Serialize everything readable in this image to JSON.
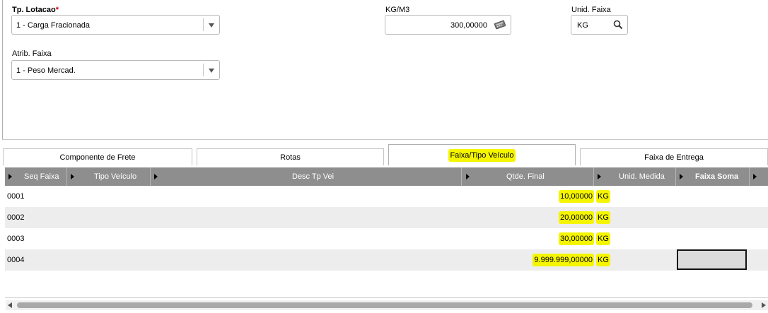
{
  "form": {
    "tp_lotacao": {
      "label": "Tp. Lotacao",
      "required_mark": "*",
      "value": "1 - Carga Fracionada"
    },
    "kg_m3": {
      "label": "KG/M3",
      "value": "300,00000",
      "icon": "calculator-icon"
    },
    "unid_faixa": {
      "label": "Unid. Faixa",
      "value": "KG",
      "icon": "search-icon"
    },
    "atrib_faixa": {
      "label": "Atrib. Faixa",
      "value": "1 - Peso Mercad."
    }
  },
  "tabs": [
    {
      "label": "Componente de Frete",
      "active": false
    },
    {
      "label": "Rotas",
      "active": false
    },
    {
      "label": "Faixa/Tipo Veículo",
      "active": true
    },
    {
      "label": "Faixa de Entrega",
      "active": false
    }
  ],
  "grid": {
    "columns": [
      "Seq Faixa",
      "Tipo Veículo",
      "Desc Tp Vei",
      "Qtde. Final",
      "Unid. Medida",
      "Faixa Soma"
    ],
    "rows": [
      {
        "seq": "0001",
        "qtde": "10,00000",
        "unid": "KG"
      },
      {
        "seq": "0002",
        "qtde": "20,00000",
        "unid": "KG"
      },
      {
        "seq": "0003",
        "qtde": "30,00000",
        "unid": "KG"
      },
      {
        "seq": "0004",
        "qtde": "9.999.999,00000",
        "unid": "KG"
      }
    ]
  },
  "colors": {
    "highlight": "#f5f500",
    "grid_header": "#8e8e8e"
  }
}
